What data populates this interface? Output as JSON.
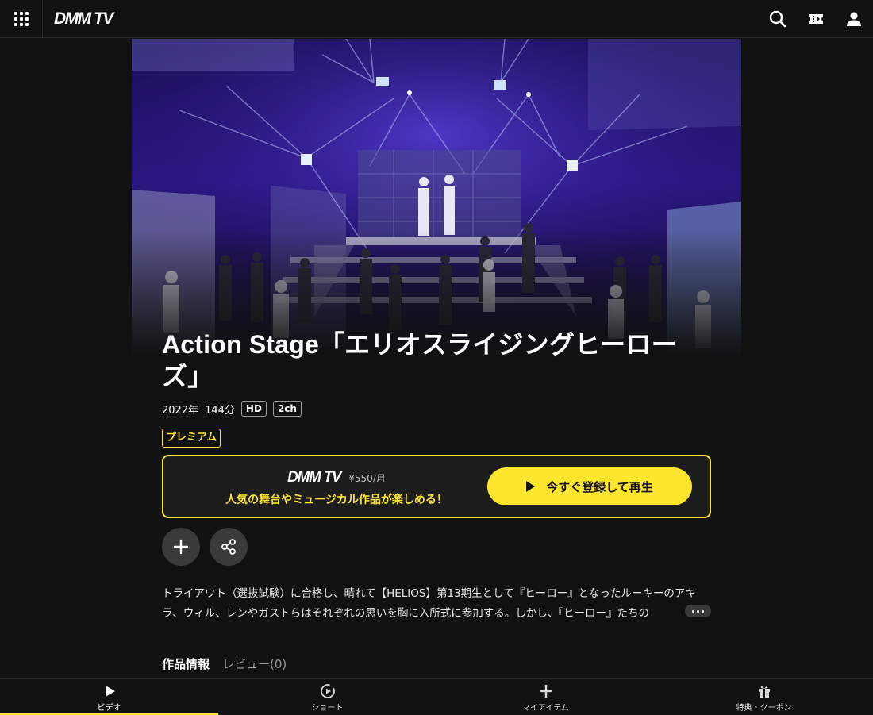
{
  "header": {
    "logo_text": "DMM TV",
    "menu_icon": "grid-menu-icon",
    "search_icon": "search-icon",
    "ticket_icon": "ticket-icon",
    "account_icon": "user-icon"
  },
  "work": {
    "title": "Action Stage「エリオスライジングヒーローズ」",
    "year": "2022年",
    "duration": "144分",
    "quality_badge": "HD",
    "audio_badge": "2ch",
    "plan_badge": "プレミアム"
  },
  "promo": {
    "logo_text": "DMM TV",
    "price": "¥550/月",
    "message": "人気の舞台やミュージカル作品が楽しめる！",
    "button_label": "今すぐ登録して再生"
  },
  "actions": {
    "add_icon": "plus-icon",
    "share_icon": "share-icon"
  },
  "synopsis": {
    "text": "トライアウト（選抜試験）に合格し、晴れて【HELIOS】第13期生として『ヒーロー』となったルーキーのアキラ、ウィル、レンやガストらはそれぞれの思いを胸に入所式に参加する。しかし、『ヒーロー』たちの"
  },
  "tabs": {
    "info": "作品情報",
    "review": "レビュー(0)"
  },
  "bottom_nav": {
    "items": [
      {
        "label": "ビデオ",
        "icon": "play-icon",
        "active": true
      },
      {
        "label": "ショート",
        "icon": "short-video-icon",
        "active": false
      },
      {
        "label": "マイアイテム",
        "icon": "plus-icon",
        "active": false
      },
      {
        "label": "特典・クーポン",
        "icon": "gift-icon",
        "active": false
      }
    ]
  },
  "colors": {
    "accent": "#ffe62e",
    "background": "#111111",
    "button_gray": "#3a3a3a"
  }
}
